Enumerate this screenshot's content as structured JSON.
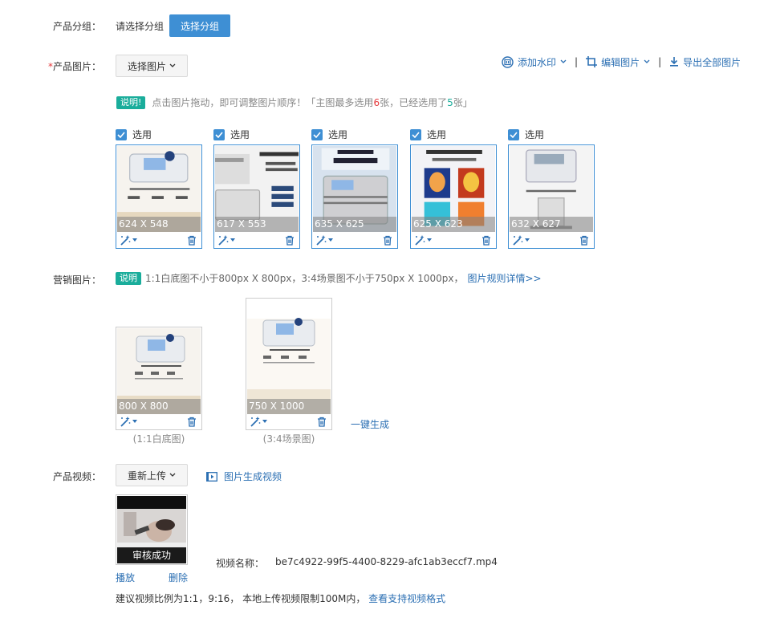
{
  "group": {
    "label": "产品分组：",
    "placeholder": "请选择分组",
    "button": "选择分组"
  },
  "product_images": {
    "required_mark": "*",
    "label": "产品图片：",
    "select_button": "选择图片",
    "toolbar": {
      "watermark": "添加水印",
      "edit": "编辑图片",
      "export": "导出全部图片",
      "separator": "|"
    },
    "notice": {
      "badge": "说明!",
      "text_prefix": "点击图片拖动，即可调整图片顺序！「主图最多选用",
      "max": "6",
      "text_mid": "张，已经选用了",
      "used": "5",
      "text_suffix": "张」",
      "max_color": "#e4393c",
      "used_color": "#1aad9b"
    },
    "items": [
      {
        "check_label": "选用",
        "dims": "624 X 548"
      },
      {
        "check_label": "选用",
        "dims": "617 X 553"
      },
      {
        "check_label": "选用",
        "dims": "635 X 625"
      },
      {
        "check_label": "选用",
        "dims": "625 X 623"
      },
      {
        "check_label": "选用",
        "dims": "632 X 627"
      }
    ]
  },
  "marketing": {
    "label": "营销图片：",
    "badge": "说明",
    "text": "1:1白底图不小于800px X 800px，3:4场景图不小于750px X 1000px，",
    "rules_link": "图片规则详情>>",
    "items": [
      {
        "dims": "800 X 800",
        "caption": "(1:1白底图)"
      },
      {
        "dims": "750 X 1000",
        "caption": "(3:4场景图)"
      }
    ],
    "generate_link": "一键生成"
  },
  "video": {
    "label": "产品视频：",
    "reupload_button": "重新上传",
    "generate_link": "图片生成视频",
    "status": "审核成功",
    "play": "播放",
    "delete": "删除",
    "name_label": "视频名称：",
    "file_name": "be7c4922-99f5-4400-8229-afc1ab3eccf7.mp4",
    "hint": "建议视频比例为1:1，9:16， 本地上传视频限制100M内，",
    "formats_link": "查看支持视频格式"
  },
  "colors": {
    "accent": "#3e8fd4",
    "link": "#2b6fb3",
    "teal": "#1aad9b"
  }
}
